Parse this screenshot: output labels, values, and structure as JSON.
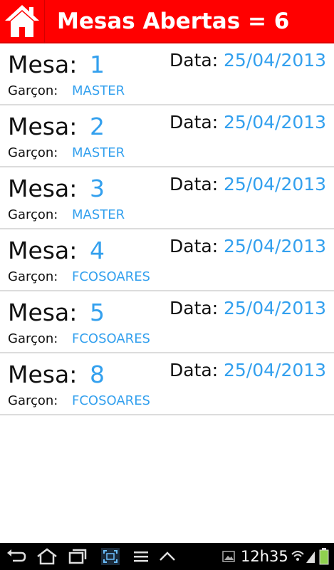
{
  "header": {
    "title": "Mesas Abertas = 6",
    "home_icon": "home-icon"
  },
  "labels": {
    "mesa": "Mesa:",
    "data": "Data:",
    "garcon": "Garçon:"
  },
  "tables": [
    {
      "mesa": "1",
      "data": "25/04/2013",
      "garcon": "MASTER"
    },
    {
      "mesa": "2",
      "data": "25/04/2013",
      "garcon": "MASTER"
    },
    {
      "mesa": "3",
      "data": "25/04/2013",
      "garcon": "MASTER"
    },
    {
      "mesa": "4",
      "data": "25/04/2013",
      "garcon": "FCOSOARES"
    },
    {
      "mesa": "5",
      "data": "25/04/2013",
      "garcon": "FCOSOARES"
    },
    {
      "mesa": "8",
      "data": "25/04/2013",
      "garcon": "FCOSOARES"
    }
  ],
  "status": {
    "time": "12h35"
  },
  "colors": {
    "accent": "#ff0000",
    "value": "#33a0ee",
    "navbar": "#000000"
  }
}
